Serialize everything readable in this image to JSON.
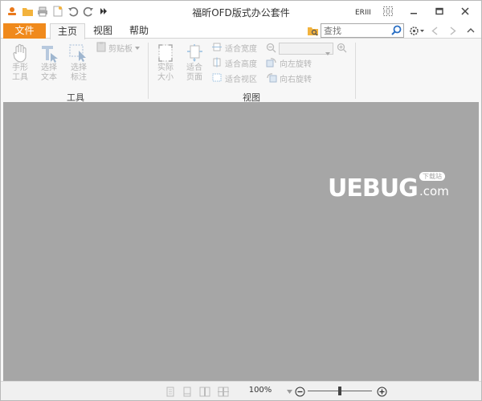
{
  "window": {
    "title": "福昕OFD版式办公套件",
    "accent_color": "#f08a1c",
    "workspace_color": "#a6a6a6"
  },
  "quick_access": [
    "app-logo-icon",
    "open-folder-icon",
    "print-icon",
    "new-doc-icon",
    "undo-icon",
    "redo-icon",
    "more-icon"
  ],
  "title_buttons": [
    "ribbon-mode-icon",
    "layout-icon",
    "minimize-icon",
    "restore-icon",
    "close-icon"
  ],
  "tabs": {
    "file": "文件",
    "home": "主页",
    "view": "视图",
    "help": "帮助"
  },
  "search": {
    "placeholder": "查找"
  },
  "ribbon": {
    "hand_tool": [
      "手形",
      "工具"
    ],
    "select_text": [
      "选择",
      "文本"
    ],
    "select_annotation": [
      "选择",
      "标注"
    ],
    "clipboard": "剪贴板",
    "group_tools": "工具",
    "actual_size": [
      "实际",
      "大小"
    ],
    "fit_page": [
      "适合",
      "页面"
    ],
    "fit_width": "适合宽度",
    "fit_height": "适合高度",
    "fit_visible": "适合视区",
    "rotate_left": "向左旋转",
    "rotate_right": "向右旋转",
    "group_view": "视图"
  },
  "watermark": {
    "text": "UEBUG",
    "suffix": ".com",
    "badge": "下载站"
  },
  "statusbar": {
    "zoom": "100%",
    "zoom_level": 1.0
  }
}
